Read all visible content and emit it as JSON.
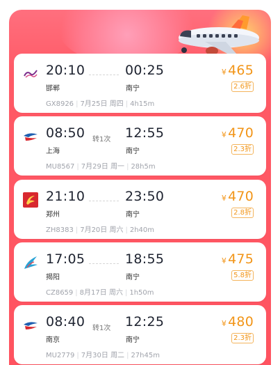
{
  "flights": [
    {
      "airline_icon": "airline-logo-purple",
      "dep_time": "20:10",
      "dep_city": "邯郸",
      "arr_time": "00:25",
      "arr_city": "南宁",
      "transfer": "",
      "currency": "¥",
      "price": "465",
      "discount": "2.6折",
      "flight_no": "GX8926",
      "date": "7月25日",
      "weekday": "周四",
      "duration": "4h15m"
    },
    {
      "airline_icon": "china-eastern-logo",
      "dep_time": "08:50",
      "dep_city": "上海",
      "arr_time": "12:55",
      "arr_city": "南宁",
      "transfer": "转1次",
      "currency": "¥",
      "price": "470",
      "discount": "2.3折",
      "flight_no": "MU8567",
      "date": "7月29日",
      "weekday": "周一",
      "duration": "28h5m"
    },
    {
      "airline_icon": "juneyao-logo",
      "dep_time": "21:10",
      "dep_city": "郑州",
      "arr_time": "23:50",
      "arr_city": "南宁",
      "transfer": "",
      "currency": "¥",
      "price": "470",
      "discount": "2.8折",
      "flight_no": "ZH8383",
      "date": "7月20日",
      "weekday": "周六",
      "duration": "2h40m"
    },
    {
      "airline_icon": "china-southern-logo",
      "dep_time": "17:05",
      "dep_city": "揭阳",
      "arr_time": "18:55",
      "arr_city": "南宁",
      "transfer": "",
      "currency": "¥",
      "price": "475",
      "discount": "5.8折",
      "flight_no": "CZ8659",
      "date": "8月17日",
      "weekday": "周六",
      "duration": "1h50m"
    },
    {
      "airline_icon": "china-eastern-logo",
      "dep_time": "08:40",
      "dep_city": "南京",
      "arr_time": "12:25",
      "arr_city": "南宁",
      "transfer": "转1次",
      "currency": "¥",
      "price": "480",
      "discount": "2.3折",
      "flight_no": "MU2779",
      "date": "7月30日",
      "weekday": "周二",
      "duration": "27h45m"
    }
  ],
  "colors": {
    "price": "#f29518",
    "banner": "#ff5a66",
    "china_eastern": "#1f5fb0",
    "china_eastern_red": "#d8282f",
    "china_southern": "#29a3d6",
    "juneyao": "#d8282f",
    "purple_airline": "#7b2e8c"
  }
}
